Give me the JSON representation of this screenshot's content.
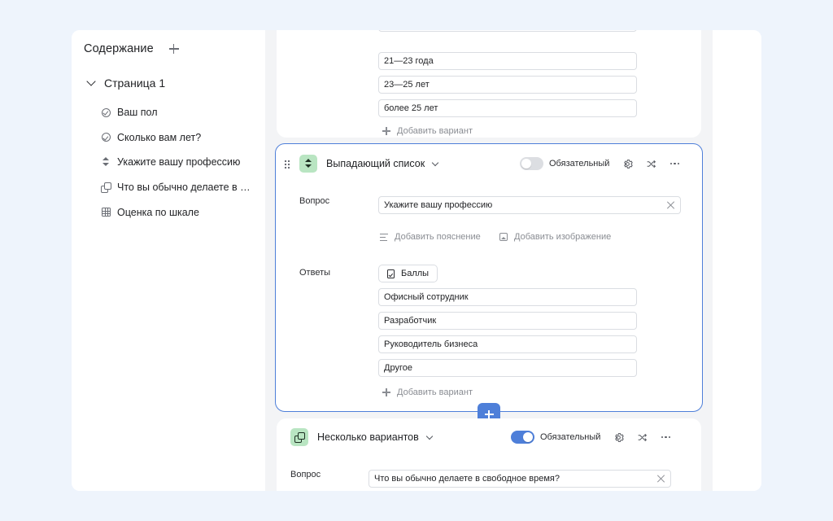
{
  "sidebar": {
    "title": "Содержание",
    "page_label": "Страница 1",
    "items": [
      {
        "label": "Ваш пол",
        "icon": "check-circle-icon"
      },
      {
        "label": "Сколько вам лет?",
        "icon": "check-circle-icon"
      },
      {
        "label": "Укажите вашу профессию",
        "icon": "dropdown-icon"
      },
      {
        "label": "Что вы обычно делаете в св...",
        "icon": "multi-choice-icon"
      },
      {
        "label": "Оценка по шкале",
        "icon": "grid-icon"
      }
    ]
  },
  "prev_question": {
    "options": [
      "21—23 года",
      "23—25 лет",
      "более 25 лет"
    ],
    "add_option_label": "Добавить вариант"
  },
  "dropdown_question": {
    "type_label": "Выпадающий список",
    "required_label": "Обязательный",
    "required": false,
    "question_label": "Вопрос",
    "question_value": "Укажите вашу профессию",
    "add_description_label": "Добавить пояснение",
    "add_image_label": "Добавить изображение",
    "answers_label": "Ответы",
    "scores_label": "Баллы",
    "options": [
      "Офисный сотрудник",
      "Разработчик",
      "Руководитель бизнеса",
      "Другое"
    ],
    "add_option_label": "Добавить вариант"
  },
  "multi_question": {
    "type_label": "Несколько вариантов",
    "required_label": "Обязательный",
    "required": true,
    "question_label": "Вопрос",
    "question_value": "Что вы обычно делаете в свободное время?"
  },
  "colors": {
    "accent": "#4e7fd9",
    "type_badge": "#b9e5c2",
    "background": "#eef4fc"
  }
}
